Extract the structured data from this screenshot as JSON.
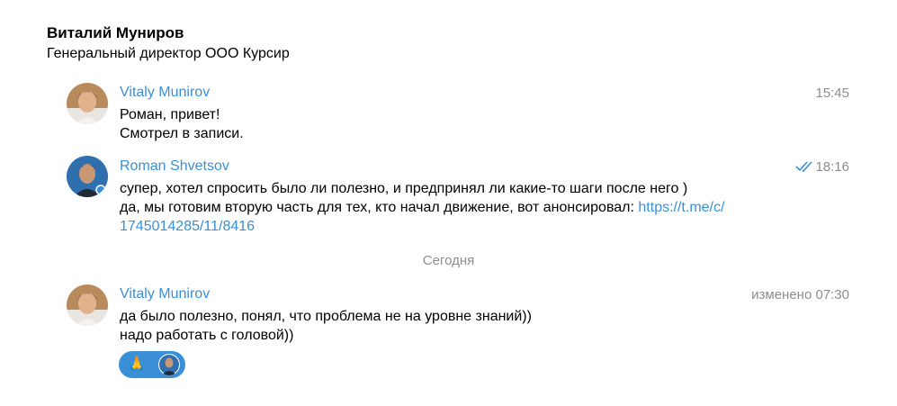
{
  "header": {
    "name": "Виталий Муниров",
    "subtitle": "Генеральный директор ООО Курсир"
  },
  "messages": [
    {
      "author": "Vitaly Munirov",
      "time": "15:45",
      "lines": [
        "Роман, привет!",
        "Смотрел в записи."
      ]
    },
    {
      "author": "Roman Shvetsov",
      "time": "18:16",
      "status_icon": "double-check-icon",
      "lines": [
        "супер, хотел спросить было ли полезно, и предпринял ли какие-то шаги после него )",
        "да, мы готовим вторую часть для тех, кто начал движение, вот анонсировал: "
      ],
      "link_part1": "https://t.me/c/",
      "link_part2": "1745014285/11/8416"
    },
    {
      "author": "Vitaly Munirov",
      "time": "изменено 07:30",
      "lines": [
        "да было полезно, понял, что проблема не на уровне знаний))",
        "надо работать с головой))"
      ],
      "reaction": {
        "emoji": "🙏",
        "icon": "praying-hands-icon"
      }
    }
  ],
  "date_separator": "Сегодня",
  "colors": {
    "accent": "#3a8fd6",
    "meta": "#8d8d8d"
  }
}
